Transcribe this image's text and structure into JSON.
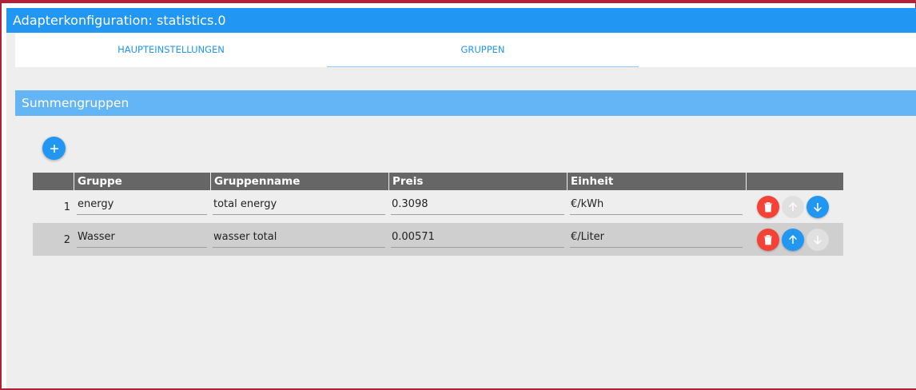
{
  "window": {
    "title": "Adapterkonfiguration: statistics.0"
  },
  "tabs": [
    {
      "label": "HAUPTEINSTELLUNGEN",
      "active": false
    },
    {
      "label": "GRUPPEN",
      "active": true
    }
  ],
  "section": {
    "title": "Summengruppen"
  },
  "add_button": {
    "icon": "plus-icon"
  },
  "table": {
    "headers": [
      "Gruppe",
      "Gruppenname",
      "Preis",
      "Einheit"
    ],
    "rows": [
      {
        "num": "1",
        "gruppe": "energy",
        "gruppenname": "total energy",
        "preis": "0.3098",
        "einheit": "€/kWh",
        "up_enabled": false,
        "down_enabled": true
      },
      {
        "num": "2",
        "gruppe": "Wasser",
        "gruppenname": "wasser total",
        "preis": "0.00571",
        "einheit": "€/Liter",
        "up_enabled": true,
        "down_enabled": false
      }
    ]
  },
  "colors": {
    "primary": "#2196f3",
    "section": "#64b5f6",
    "delete": "#f44336",
    "disabled": "#e0e0e0",
    "header": "#666666"
  }
}
